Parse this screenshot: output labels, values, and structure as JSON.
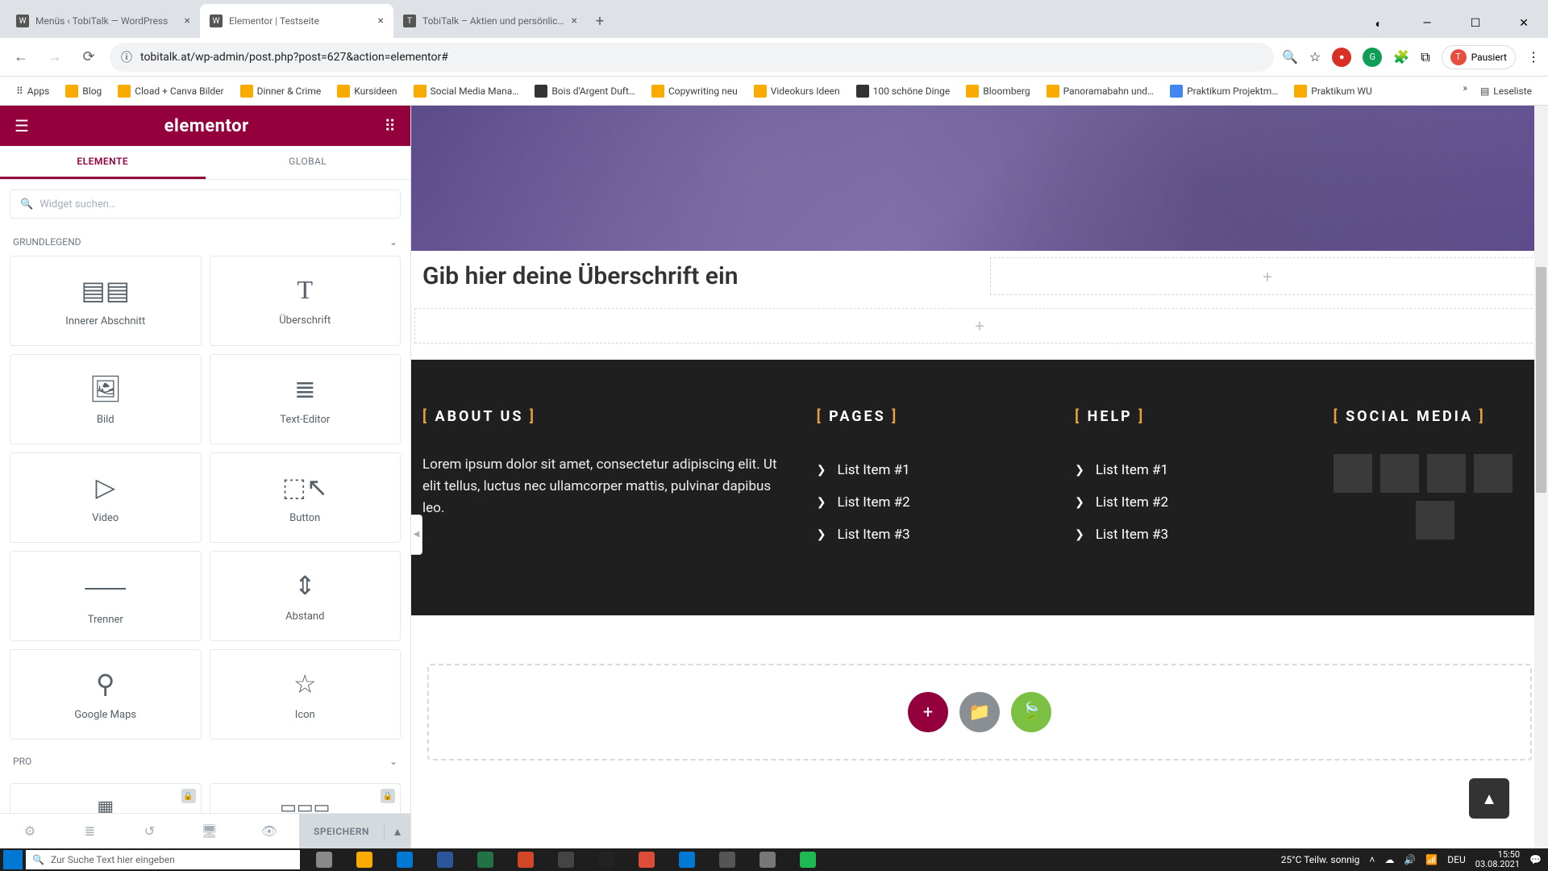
{
  "browser": {
    "tabs": [
      {
        "title": "Menüs ‹ TobiTalk — WordPress",
        "active": false
      },
      {
        "title": "Elementor | Testseite",
        "active": true
      },
      {
        "title": "TobiTalk – Aktien und persönlich…",
        "active": false
      }
    ],
    "url": "tobitalk.at/wp-admin/post.php?post=627&action=elementor#",
    "pause": "Pausiert",
    "avatar_letter": "T",
    "bookmarks": [
      "Apps",
      "Blog",
      "Cload + Canva Bilder",
      "Dinner & Crime",
      "Kursideen",
      "Social Media Mana…",
      "Bois d'Argent Duft…",
      "Copywriting neu",
      "Videokurs Ideen",
      "100 schöne Dinge",
      "Bloomberg",
      "Panoramabahn und…",
      "Praktikum Projektm…",
      "Praktikum WU"
    ],
    "readlist": "Leseliste"
  },
  "sidebar": {
    "logo": "elementor",
    "tabs": {
      "elements": "ELEMENTE",
      "global": "GLOBAL"
    },
    "search_placeholder": "Widget suchen…",
    "sections": {
      "basic": "GRUNDLEGEND",
      "pro": "PRO"
    },
    "widgets": [
      {
        "label": "Innerer Abschnitt",
        "icon": "≡≡"
      },
      {
        "label": "Überschrift",
        "icon": "T"
      },
      {
        "label": "Bild",
        "icon": "▣"
      },
      {
        "label": "Text-Editor",
        "icon": "≡"
      },
      {
        "label": "Video",
        "icon": "▷"
      },
      {
        "label": "Button",
        "icon": "⬚"
      },
      {
        "label": "Trenner",
        "icon": "⸺"
      },
      {
        "label": "Abstand",
        "icon": "⇕"
      },
      {
        "label": "Google Maps",
        "icon": "⚲"
      },
      {
        "label": "Icon",
        "icon": "☆"
      }
    ],
    "save": "SPEICHERN"
  },
  "canvas": {
    "heading": "Gib hier deine Überschrift ein",
    "footer": {
      "about": {
        "title": "ABOUT US",
        "text": "Lorem ipsum dolor sit amet, consectetur adipiscing elit. Ut elit tellus, luctus nec ullamcorper mattis, pulvinar dapibus leo."
      },
      "pages": {
        "title": "PAGES",
        "items": [
          "List Item #1",
          "List Item #2",
          "List Item #3"
        ]
      },
      "help": {
        "title": "HELP",
        "items": [
          "List Item #1",
          "List Item #2",
          "List Item #3"
        ]
      },
      "social": {
        "title": "SOCIAL MEDIA"
      }
    }
  },
  "taskbar": {
    "search": "Zur Suche Text hier eingeben",
    "weather": "25°C  Teilw. sonnig",
    "time": "15:50",
    "date": "03.08.2021",
    "lang": "DEU"
  }
}
